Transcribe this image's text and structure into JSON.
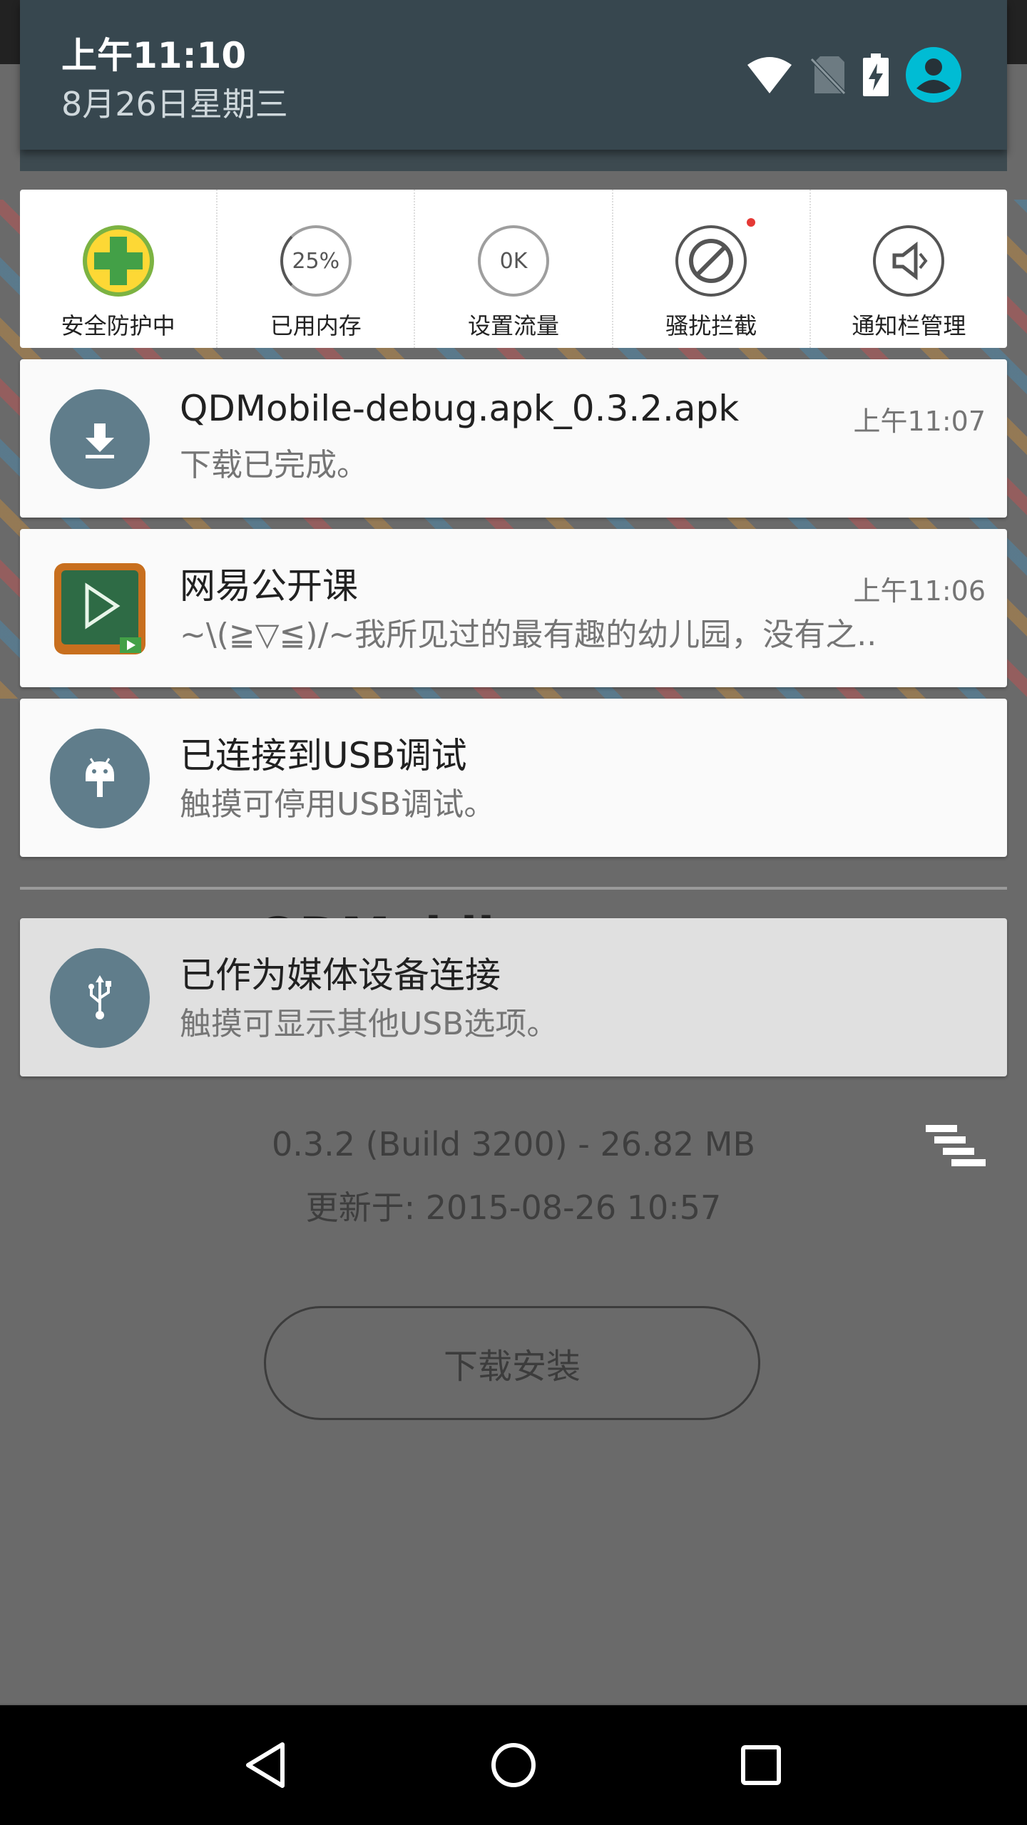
{
  "status": {
    "time": "上午11:10",
    "date": "8月26日星期三"
  },
  "quick_settings": [
    {
      "label": "安全防护中",
      "icon": "shield-plus-icon"
    },
    {
      "label": "已用内存",
      "value": "25%",
      "icon": "memory-gauge-icon"
    },
    {
      "label": "设置流量",
      "value": "0K",
      "icon": "data-gauge-icon"
    },
    {
      "label": "骚扰拦截",
      "icon": "block-icon"
    },
    {
      "label": "通知栏管理",
      "icon": "speaker-icon"
    }
  ],
  "notifications": [
    {
      "title": "QDMobile-debug.apk_0.3.2.apk",
      "text": "下载已完成。",
      "time": "上午11:07",
      "icon": "download-icon"
    },
    {
      "title": "网易公开课",
      "text": "~\\(≧▽≦)/~我所见过的最有趣的幼儿园，没有之..",
      "time": "上午11:06",
      "icon": "play-board-icon"
    },
    {
      "title": "已连接到USB调试",
      "text": "触摸可停用USB调试。",
      "icon": "android-icon"
    },
    {
      "title": "已作为媒体设备连接",
      "text": "触摸可显示其他USB选项。",
      "icon": "usb-icon"
    }
  ],
  "background": {
    "app_title_partial": "QDMobile",
    "version_info": "0.3.2 (Build 3200) - 26.82 MB",
    "updated": "更新于: 2015-08-26 10:57",
    "install_label": "下载安装"
  },
  "colors": {
    "header_bg": "#37474f",
    "notif_icon_bg": "#607d8b",
    "accent_avatar": "#00bcd4"
  }
}
